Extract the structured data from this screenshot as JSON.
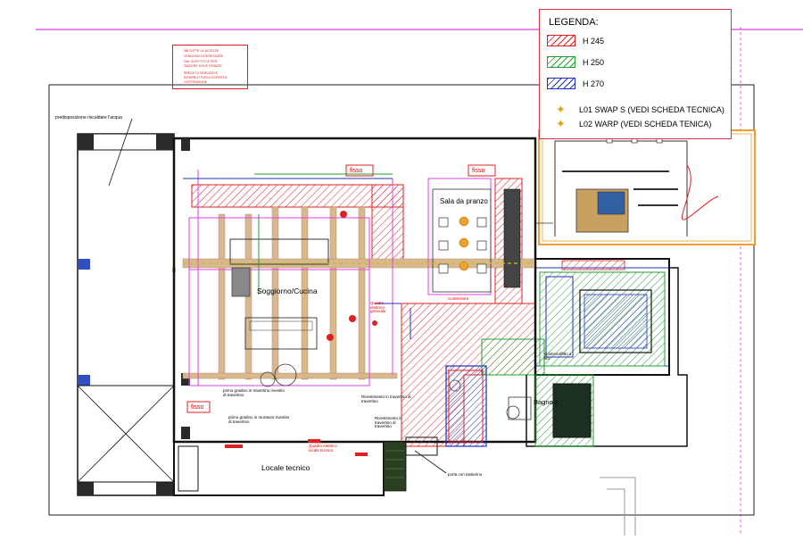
{
  "legend": {
    "title": "LEGENDA:",
    "items": [
      {
        "label": "H 245",
        "color": "#e02020"
      },
      {
        "label": "H 250",
        "color": "#20a030"
      },
      {
        "label": "H 270",
        "color": "#2030c0"
      }
    ],
    "lights": [
      {
        "label": "L01 SWAP S (VEDI SCHEDA TECNICA)",
        "icon": "star-light-icon"
      },
      {
        "label": "L02 WARP (VEDI SCHEDA TENICA)",
        "icon": "star-light-icon"
      }
    ]
  },
  "rooms": {
    "living": "Soggiorno/Cucina",
    "dining": "Sala da pranzo",
    "bath": "Bagno 1",
    "tech": "Locale tecnico"
  },
  "labels": {
    "drain": "predisposizione riscaldare l'acqua",
    "fisso_1": "fisso",
    "fisso_2": "fisso",
    "fisso_3": "fisso",
    "quadro_generale": "Quadro elettrico generale",
    "step_1": "primo gradino in travertino rivestito di travertino",
    "step_2": "primo gradino in muratura rivestito di travertino",
    "rivestimento_1": "Rivestimento in travertino di travertino",
    "rivestimento_2": "Rivestimento in travertino di travertino",
    "quadro_tecnico": "Quadro elettrico locale tecnico",
    "porta": "porta con tastierino",
    "contenitore": "Contenitore",
    "controsoffitto": "Controsoffitto a filo"
  },
  "note_lines": [
    "NB TUTTE LE ALTEZZE",
    "VENGONO INTERESSATE",
    "DAL SOFFITTO E PER",
    "PIACERE DOVE STIBATE",
    "PREDE DI SERVIZIO E",
    "INTERRUTTORI A SOFFITTO",
    "COSTRUZIONE"
  ],
  "colors": {
    "red": "#e02020",
    "green": "#20a030",
    "blue": "#2030c0",
    "magenta": "#e040e0",
    "orange": "#f0a030",
    "wood": "#d8b890",
    "wall": "#1c1c1c"
  }
}
